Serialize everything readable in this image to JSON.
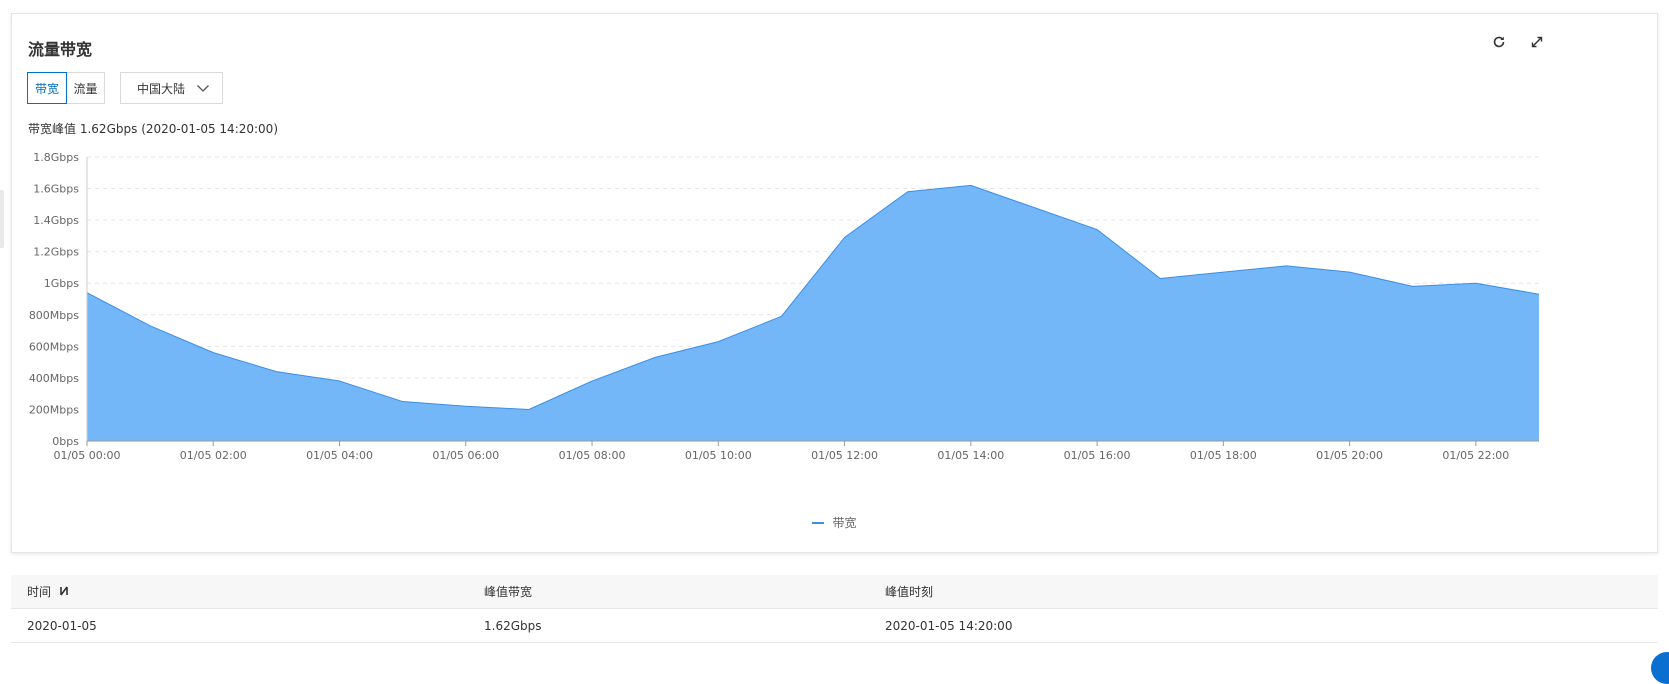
{
  "card": {
    "title": "流量带宽",
    "refresh_icon": "refresh-icon",
    "fullscreen_icon": "fullscreen-icon"
  },
  "tabs": [
    {
      "label": "带宽",
      "active": true
    },
    {
      "label": "流量",
      "active": false
    }
  ],
  "region_select": {
    "value": "中国大陆",
    "icon": "chevron-down-icon"
  },
  "peak": {
    "label": "带宽峰值",
    "value": "1.62Gbps",
    "time": "(2020-01-05 14:20:00)"
  },
  "colors": {
    "area_fill": "#74b7f8",
    "area_line": "#3a8ee6",
    "active_blue": "#0070cc",
    "grid": "#e6e6e6"
  },
  "chart_data": {
    "type": "area",
    "y_ticks": [
      "0bps",
      "200Mbps",
      "400Mbps",
      "600Mbps",
      "800Mbps",
      "1Gbps",
      "1.2Gbps",
      "1.4Gbps",
      "1.6Gbps",
      "1.8Gbps"
    ],
    "ylim": [
      0,
      1.8
    ],
    "y_unit": "Gbps",
    "x_tick_labels": [
      "01/05 00:00",
      "01/05 02:00",
      "01/05 04:00",
      "01/05 06:00",
      "01/05 08:00",
      "01/05 10:00",
      "01/05 12:00",
      "01/05 14:00",
      "01/05 16:00",
      "01/05 18:00",
      "01/05 20:00",
      "01/05 22:00"
    ],
    "x_hours": [
      0,
      1,
      2,
      3,
      4,
      5,
      6,
      7,
      8,
      9,
      10,
      11,
      12,
      13,
      14,
      15,
      16,
      17,
      18,
      19,
      20,
      21,
      22,
      23
    ],
    "xlim": [
      0,
      23
    ],
    "grid": true,
    "legend_position": "bottom-center",
    "series": [
      {
        "name": "带宽",
        "values": [
          0.94,
          0.73,
          0.56,
          0.44,
          0.38,
          0.25,
          0.22,
          0.2,
          0.38,
          0.53,
          0.63,
          0.79,
          1.29,
          1.58,
          1.62,
          1.48,
          1.34,
          1.03,
          1.07,
          1.11,
          1.07,
          0.98,
          1.0,
          0.93
        ]
      }
    ]
  },
  "legend": {
    "label": "带宽"
  },
  "table": {
    "headers": {
      "time": "时间",
      "peak_bw": "峰值带宽",
      "peak_time": "峰值时刻"
    },
    "sort_icon": "sort-icon",
    "rows": [
      {
        "time": "2020-01-05",
        "peak_bw": "1.62Gbps",
        "peak_time": "2020-01-05 14:20:00"
      }
    ]
  }
}
